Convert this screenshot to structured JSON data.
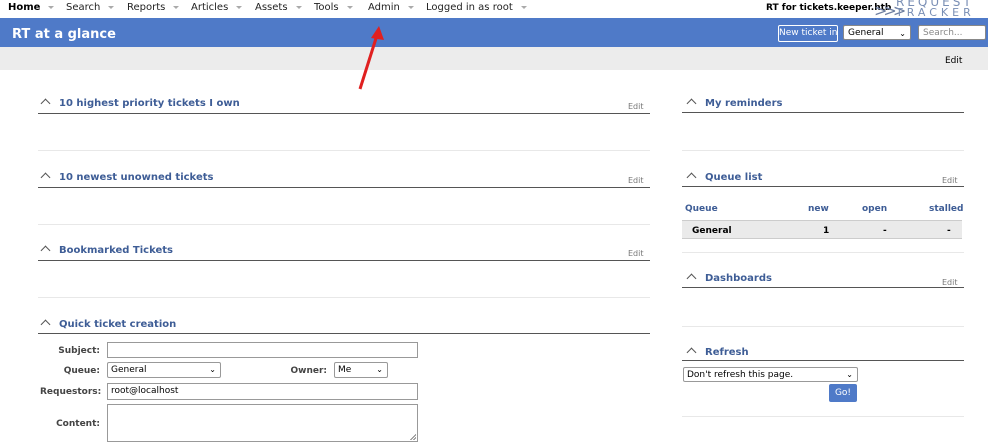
{
  "topnav": {
    "items": [
      {
        "label": "Home"
      },
      {
        "label": "Search"
      },
      {
        "label": "Reports"
      },
      {
        "label": "Articles"
      },
      {
        "label": "Assets"
      },
      {
        "label": "Tools"
      },
      {
        "label": "Admin"
      },
      {
        "label": "Logged in as root"
      }
    ],
    "site_label": "RT for tickets.keeper.htb",
    "logo_line1": "REQUEST",
    "logo_line2": "TRACKER"
  },
  "header": {
    "title": "RT at a glance",
    "new_ticket_label": "New ticket in",
    "queue_value": "General",
    "search_placeholder": "Search..."
  },
  "editbar": {
    "edit_label": "Edit"
  },
  "sections": {
    "priority": {
      "title": "10 highest priority tickets I own",
      "edit": "Edit"
    },
    "unowned": {
      "title": "10 newest unowned tickets",
      "edit": "Edit"
    },
    "bookmarked": {
      "title": "Bookmarked Tickets",
      "edit": "Edit"
    },
    "quick_create": {
      "title": "Quick ticket creation"
    },
    "reminders": {
      "title": "My reminders"
    },
    "queue_list": {
      "title": "Queue list",
      "edit": "Edit"
    },
    "dashboards": {
      "title": "Dashboards",
      "edit": "Edit"
    },
    "refresh": {
      "title": "Refresh"
    }
  },
  "queue_list": {
    "headers": [
      "Queue",
      "new",
      "open",
      "stalled"
    ],
    "rows": [
      [
        "General",
        "1",
        "-",
        "-"
      ]
    ]
  },
  "quick_create": {
    "subject_label": "Subject:",
    "subject_value": "",
    "queue_label": "Queue:",
    "queue_value": "General",
    "owner_label": "Owner:",
    "owner_value": "Me",
    "requestors_label": "Requestors:",
    "requestors_value": "root@localhost",
    "content_label": "Content:",
    "content_value": ""
  },
  "refresh": {
    "select_value": "Don't refresh this page.",
    "go_label": "Go!"
  },
  "colors": {
    "accent": "#4f7ac8",
    "section_title": "#3e5d96",
    "annotation_arrow": "#e02020"
  }
}
